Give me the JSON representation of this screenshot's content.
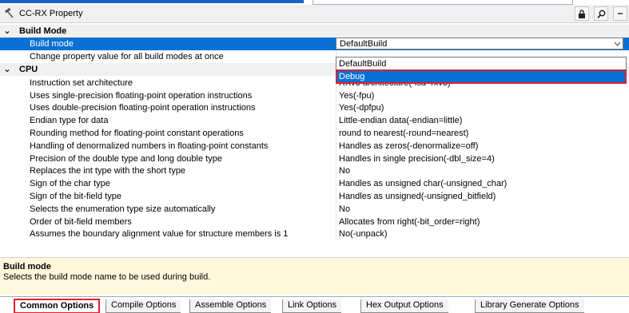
{
  "window": {
    "title": "CC-RX Property"
  },
  "categories": {
    "build_mode": "Build Mode",
    "cpu": "CPU"
  },
  "build_mode_rows": [
    {
      "name": "Build mode",
      "value": "DefaultBuild"
    },
    {
      "name": "Change property value for all build modes at once",
      "value": ""
    }
  ],
  "dropdown": {
    "options": [
      "DefaultBuild",
      "Debug"
    ],
    "highlighted": "Debug"
  },
  "cpu_rows": [
    {
      "name": "Instruction set architecture",
      "value": "RXv3 architecture(-isa=rxv3)"
    },
    {
      "name": "Uses single-precision floating-point operation instructions",
      "value": "Yes(-fpu)"
    },
    {
      "name": "Uses double-precision floating-point operation instructions",
      "value": "Yes(-dpfpu)"
    },
    {
      "name": "Endian type for data",
      "value": "Little-endian data(-endian=little)"
    },
    {
      "name": "Rounding method for floating-point constant operations",
      "value": "round to nearest(-round=nearest)"
    },
    {
      "name": "Handling of denormalized numbers in floating-point constants",
      "value": "Handles as zeros(-denormalize=off)"
    },
    {
      "name": "Precision of the double type and long double type",
      "value": "Handles in single precision(-dbl_size=4)"
    },
    {
      "name": "Replaces the int type with the short type",
      "value": "No"
    },
    {
      "name": "Sign of the char type",
      "value": "Handles as unsigned char(-unsigned_char)"
    },
    {
      "name": "Sign of the bit-field type",
      "value": "Handles as unsigned(-unsigned_bitfield)"
    },
    {
      "name": "Selects the enumeration type size automatically",
      "value": "No"
    },
    {
      "name": "Order of bit-field members",
      "value": "Allocates from right(-bit_order=right)"
    },
    {
      "name": "Assumes the boundary alignment value for structure members is 1",
      "value": "No(-unpack)"
    }
  ],
  "description": {
    "title": "Build mode",
    "text": "Selects the build mode name to be used during build."
  },
  "tabs": [
    {
      "label": "Common Options",
      "selected": true
    },
    {
      "label": "Compile Options",
      "selected": false
    },
    {
      "label": "Assemble Options",
      "selected": false
    },
    {
      "label": "Link Options",
      "selected": false
    },
    {
      "label": "Hex Output Options",
      "selected": false
    },
    {
      "label": "Library Generate Options",
      "selected": false
    }
  ],
  "colors": {
    "selection_blue": "#0a70d4",
    "highlight_red": "#e02030",
    "description_bg": "#fff8dc"
  }
}
